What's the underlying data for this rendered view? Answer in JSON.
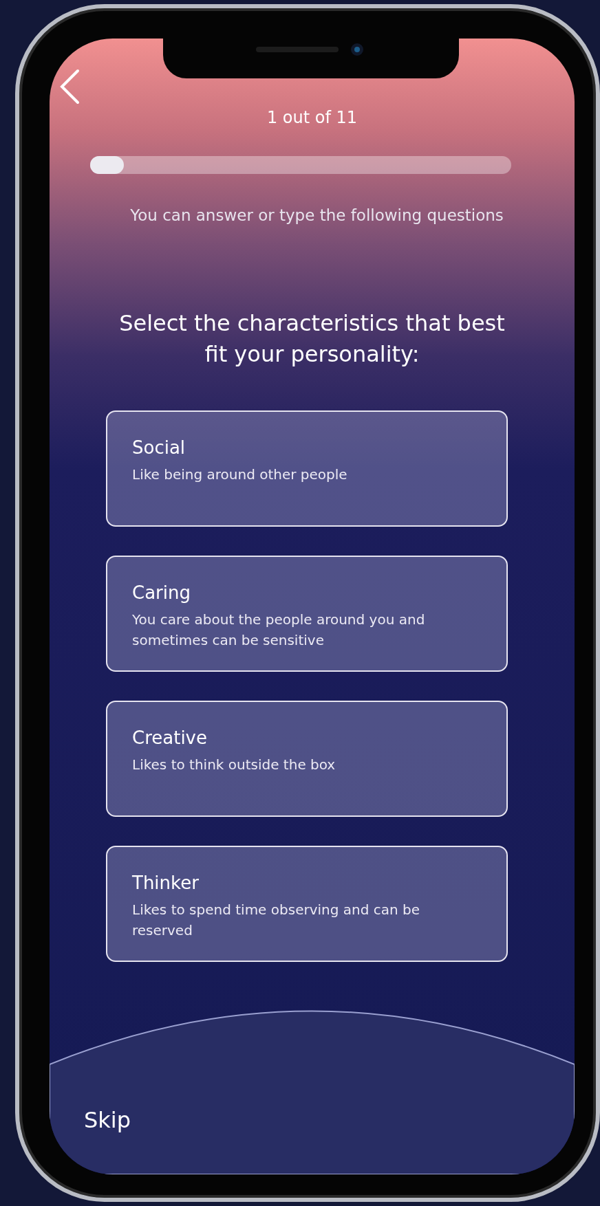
{
  "header": {
    "progress_label": "1 out of 11",
    "level": 0.08
  },
  "instruction": "You can answer or type the following questions",
  "question": "Select the characteristics that best fit your personality:",
  "options": [
    {
      "title": "Social",
      "description": "Like being around other people",
      "selected": false
    },
    {
      "title": "Caring",
      "description": "You care about the people around you and sometimes can be sensitive",
      "selected": false
    },
    {
      "title": "Creative",
      "description": "Likes to think outside the box",
      "selected": false
    },
    {
      "title": "Thinker",
      "description": "Likes to spend time observing and can be reserved",
      "selected": false
    }
  ],
  "skip": "Skip"
}
